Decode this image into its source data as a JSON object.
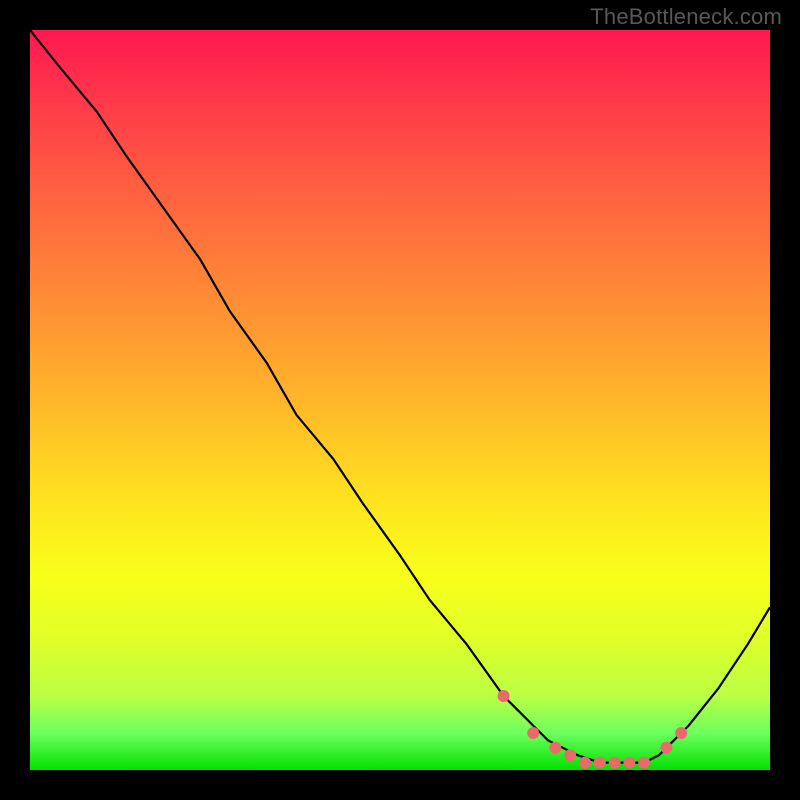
{
  "watermark": "TheBottleneck.com",
  "chart_data": {
    "type": "line",
    "title": "",
    "xlabel": "",
    "ylabel": "",
    "xlim": [
      0,
      100
    ],
    "ylim": [
      0,
      100
    ],
    "series": [
      {
        "name": "bottleneck-curve",
        "x": [
          0,
          4,
          9,
          13,
          18,
          23,
          27,
          32,
          36,
          41,
          45,
          50,
          54,
          59,
          64,
          66,
          68,
          70,
          72,
          74,
          77,
          79,
          81,
          83,
          85,
          86,
          89,
          93,
          97,
          100
        ],
        "values": [
          100,
          95,
          89,
          83,
          76,
          69,
          62,
          55,
          48,
          42,
          36,
          29,
          23,
          17,
          10,
          8,
          6,
          4,
          3,
          2,
          1,
          1,
          1,
          1,
          2,
          3,
          6,
          11,
          17,
          22
        ]
      }
    ],
    "markers": {
      "name": "highlight-dots",
      "x": [
        64,
        68,
        71,
        73,
        75,
        77,
        79,
        81,
        83,
        86,
        88
      ],
      "values": [
        10,
        5,
        3,
        2,
        1,
        1,
        1,
        1,
        1,
        3,
        5
      ]
    },
    "background_gradient": {
      "description": "vertical gradient red→orange→yellow→green representing bottleneck severity",
      "stops": [
        {
          "pos": 0.0,
          "color": "#ff1850"
        },
        {
          "pos": 0.36,
          "color": "#ff8b35"
        },
        {
          "pos": 0.64,
          "color": "#ffe41f"
        },
        {
          "pos": 0.9,
          "color": "#baff44"
        },
        {
          "pos": 1.0,
          "color": "#00e100"
        }
      ]
    }
  }
}
